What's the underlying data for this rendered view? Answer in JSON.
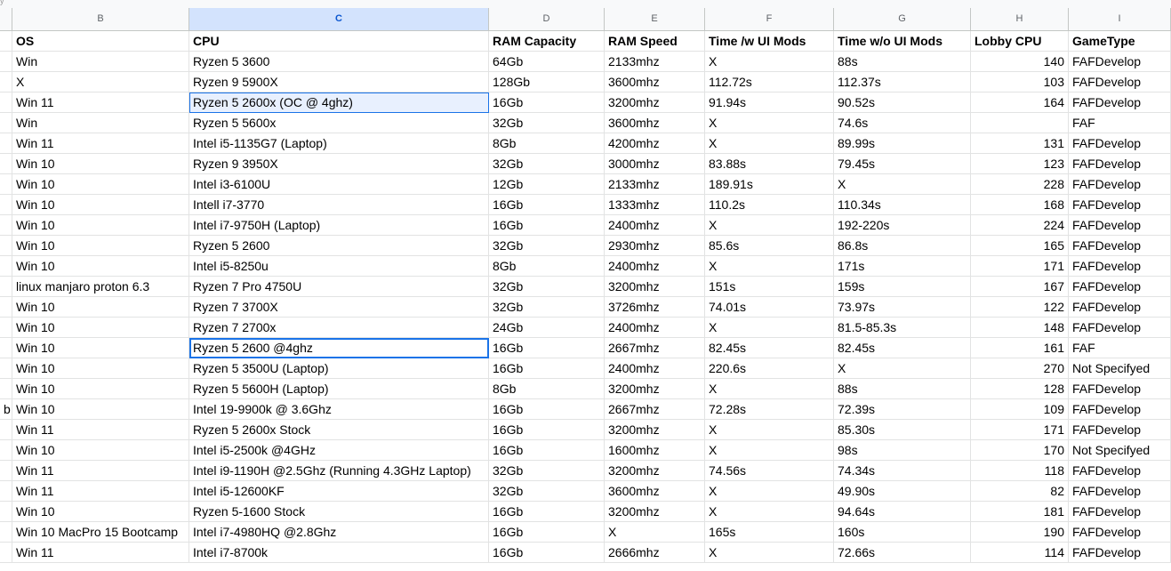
{
  "top_fragment": "y",
  "columns": [
    "B",
    "C",
    "D",
    "E",
    "F",
    "G",
    "H",
    "I"
  ],
  "headers": [
    "OS",
    "CPU",
    "RAM Capacity",
    "RAM Speed",
    "Time /w UI Mods",
    "Time w/o UI Mods",
    "Lobby CPU",
    "GameType"
  ],
  "rows": [
    [
      "",
      "Win",
      "Ryzen 5 3600",
      "64Gb",
      "2133mhz",
      "X",
      "88s",
      "140",
      "FAFDevelop"
    ],
    [
      "",
      "X",
      "Ryzen 9 5900X",
      "128Gb",
      "3600mhz",
      "112.72s",
      "112.37s",
      "103",
      "FAFDevelop"
    ],
    [
      "",
      "Win 11",
      "Ryzen 5 2600x (OC @ 4ghz)",
      "16Gb",
      "3200mhz",
      "91.94s",
      "90.52s",
      "164",
      "FAFDevelop"
    ],
    [
      "",
      "Win",
      "Ryzen 5 5600x",
      "32Gb",
      "3600mhz",
      "X",
      "74.6s",
      "",
      "FAF"
    ],
    [
      "",
      "Win 11",
      "Intel i5-1135G7 (Laptop)",
      "8Gb",
      "4200mhz",
      "X",
      "89.99s",
      "131",
      "FAFDevelop"
    ],
    [
      "",
      "Win 10",
      "Ryzen 9 3950X",
      "32Gb",
      "3000mhz",
      "83.88s",
      "79.45s",
      "123",
      "FAFDevelop"
    ],
    [
      "",
      "Win 10",
      "Intel i3-6100U",
      "12Gb",
      "2133mhz",
      "189.91s",
      "X",
      "228",
      "FAFDevelop"
    ],
    [
      "",
      "Win 10",
      "Intell i7-3770",
      "16Gb",
      "1333mhz",
      "110.2s",
      "110.34s",
      "168",
      "FAFDevelop"
    ],
    [
      "",
      "Win 10",
      "Intel i7-9750H (Laptop)",
      "16Gb",
      "2400mhz",
      "X",
      "192-220s",
      "224",
      "FAFDevelop"
    ],
    [
      "",
      "Win 10",
      "Ryzen 5 2600",
      "32Gb",
      "2930mhz",
      "85.6s",
      "86.8s",
      "165",
      "FAFDevelop"
    ],
    [
      "",
      "Win 10",
      "Intel i5-8250u",
      "8Gb",
      "2400mhz",
      "X",
      "171s",
      "171",
      "FAFDevelop"
    ],
    [
      "",
      "linux manjaro proton 6.3",
      "Ryzen 7 Pro 4750U",
      "32Gb",
      "3200mhz",
      "151s",
      "159s",
      "167",
      "FAFDevelop"
    ],
    [
      "",
      "Win 10",
      "Ryzen 7 3700X",
      "32Gb",
      "3726mhz",
      "74.01s",
      "73.97s",
      "122",
      "FAFDevelop"
    ],
    [
      "",
      "Win 10",
      "Ryzen 7 2700x",
      "24Gb",
      "2400mhz",
      "X",
      "81.5-85.3s",
      "148",
      "FAFDevelop"
    ],
    [
      "",
      "Win 10",
      "Ryzen 5 2600 @4ghz",
      "16Gb",
      "2667mhz",
      "82.45s",
      "82.45s",
      "161",
      "FAF"
    ],
    [
      "",
      "Win 10",
      "Ryzen 5 3500U (Laptop)",
      "16Gb",
      "2400mhz",
      "220.6s",
      "X",
      "270",
      "Not Specifyed"
    ],
    [
      "",
      "Win 10",
      "Ryzen 5 5600H (Laptop)",
      "8Gb",
      "3200mhz",
      "X",
      "88s",
      "128",
      "FAFDevelop"
    ],
    [
      "b",
      "Win 10",
      "Intel 19-9900k @ 3.6Ghz",
      "16Gb",
      "2667mhz",
      "72.28s",
      "72.39s",
      "109",
      "FAFDevelop"
    ],
    [
      "",
      "Win 11",
      "Ryzen 5 2600x Stock",
      "16Gb",
      "3200mhz",
      "X",
      "85.30s",
      "171",
      "FAFDevelop"
    ],
    [
      "",
      "Win 10",
      "Intel i5-2500k @4GHz",
      "16Gb",
      "1600mhz",
      "X",
      "98s",
      "170",
      "Not Specifyed"
    ],
    [
      "",
      "Win 11",
      "Intel i9-1190H @2.5Ghz (Running 4.3GHz Laptop)",
      "32Gb",
      "3200mhz",
      "74.56s",
      "74.34s",
      "118",
      "FAFDevelop"
    ],
    [
      "",
      "Win 11",
      "Intel i5-12600KF",
      "32Gb",
      "3600mhz",
      "X",
      "49.90s",
      "82",
      "FAFDevelop"
    ],
    [
      "",
      "Win 10",
      "Ryzen 5-1600 Stock",
      "16Gb",
      "3200mhz",
      "X",
      "94.64s",
      "181",
      "FAFDevelop"
    ],
    [
      "",
      "Win 10 MacPro 15 Bootcamp",
      "Intel i7-4980HQ @2.8Ghz",
      "16Gb",
      "X",
      "165s",
      "160s",
      "190",
      "FAFDevelop"
    ],
    [
      "",
      "Win 11",
      "Intel i7-8700k",
      "16Gb",
      "2666mhz",
      "X",
      "72.66s",
      "114",
      "FAFDevelop"
    ]
  ],
  "selection": {
    "active_column": "C",
    "selected_row": 14,
    "highlighted_row": 2
  }
}
